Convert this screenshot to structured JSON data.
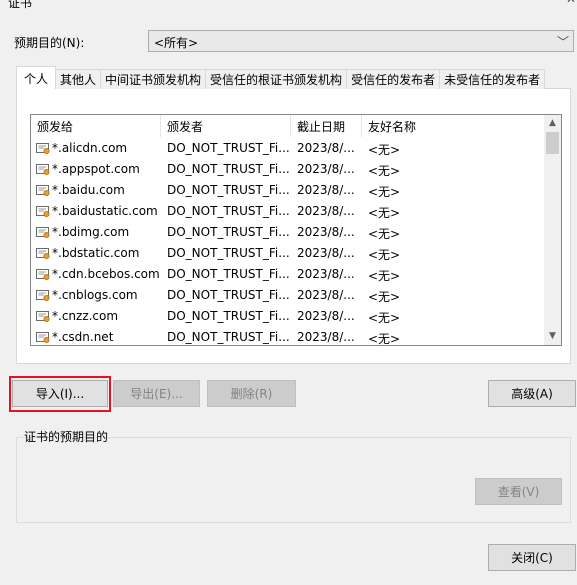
{
  "window": {
    "title": "证书"
  },
  "purpose": {
    "label": "预期目的(N):",
    "value": "<所有>"
  },
  "tabs": [
    {
      "label": "个人",
      "active": true
    },
    {
      "label": "其他人",
      "active": false
    },
    {
      "label": "中间证书颁发机构",
      "active": false
    },
    {
      "label": "受信任的根证书颁发机构",
      "active": false
    },
    {
      "label": "受信任的发布者",
      "active": false
    },
    {
      "label": "未受信任的发布者",
      "active": false
    }
  ],
  "table": {
    "columns": [
      "颁发给",
      "颁发者",
      "截止日期",
      "友好名称"
    ],
    "rows": [
      {
        "issued_to": "*.alicdn.com",
        "issuer": "DO_NOT_TRUST_Fi...",
        "expires": "2023/8/...",
        "friendly": "<无>"
      },
      {
        "issued_to": "*.appspot.com",
        "issuer": "DO_NOT_TRUST_Fi...",
        "expires": "2023/8/...",
        "friendly": "<无>"
      },
      {
        "issued_to": "*.baidu.com",
        "issuer": "DO_NOT_TRUST_Fi...",
        "expires": "2023/8/...",
        "friendly": "<无>"
      },
      {
        "issued_to": "*.baidustatic.com",
        "issuer": "DO_NOT_TRUST_Fi...",
        "expires": "2023/8/...",
        "friendly": "<无>"
      },
      {
        "issued_to": "*.bdimg.com",
        "issuer": "DO_NOT_TRUST_Fi...",
        "expires": "2023/8/...",
        "friendly": "<无>"
      },
      {
        "issued_to": "*.bdstatic.com",
        "issuer": "DO_NOT_TRUST_Fi...",
        "expires": "2023/8/...",
        "friendly": "<无>"
      },
      {
        "issued_to": "*.cdn.bcebos.com",
        "issuer": "DO_NOT_TRUST_Fi...",
        "expires": "2023/8/...",
        "friendly": "<无>"
      },
      {
        "issued_to": "*.cnblogs.com",
        "issuer": "DO_NOT_TRUST_Fi...",
        "expires": "2023/8/...",
        "friendly": "<无>"
      },
      {
        "issued_to": "*.cnzz.com",
        "issuer": "DO_NOT_TRUST_Fi...",
        "expires": "2023/8/...",
        "friendly": "<无>"
      },
      {
        "issued_to": "*.csdn.net",
        "issuer": "DO_NOT_TRUST_Fi...",
        "expires": "2023/8/...",
        "friendly": "<无>"
      }
    ]
  },
  "buttons": {
    "import": "导入(I)...",
    "export": "导出(E)...",
    "remove": "删除(R)",
    "advanced": "高级(A)",
    "view": "查看(V)",
    "close": "关闭(C)"
  },
  "purpose_group": {
    "label": "证书的预期目的"
  },
  "icons": {
    "cert": "certificate-icon",
    "dropdown": "chevron-down-icon",
    "scroll_up": "scroll-up-arrow-icon",
    "scroll_down": "scroll-down-arrow-icon"
  },
  "colors": {
    "highlight": "#e81123",
    "background": "#f0f0f0",
    "panel": "#ffffff"
  }
}
